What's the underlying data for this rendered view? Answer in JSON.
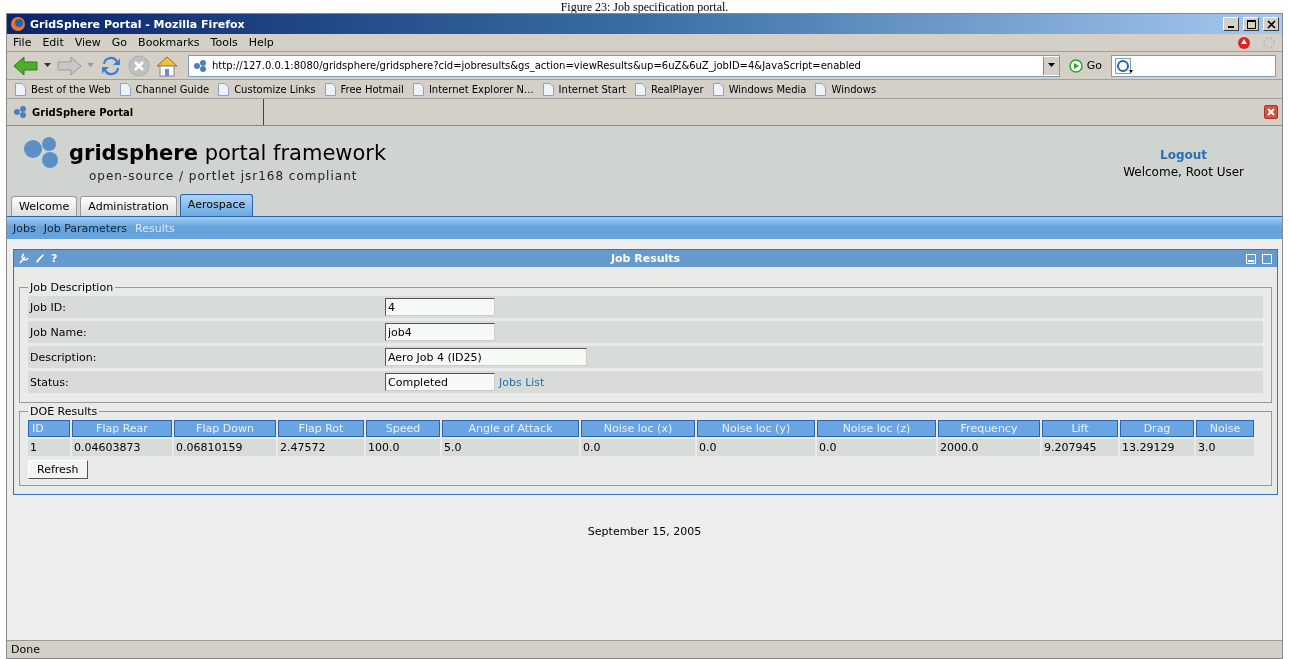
{
  "caption": "Figure 23: Job specification portal.",
  "window": {
    "title": "GridSphere Portal - Mozilla Firefox"
  },
  "menu": [
    "File",
    "Edit",
    "View",
    "Go",
    "Bookmarks",
    "Tools",
    "Help"
  ],
  "address": {
    "value": "http://127.0.0.1:8080/gridsphere/gridsphere?cid=jobresults&gs_action=viewResults&up=6uZ&6uZ_jobID=4&JavaScript=enabled",
    "go": "Go"
  },
  "bookmarks": [
    "Best of the Web",
    "Channel Guide",
    "Customize Links",
    "Free Hotmail",
    "Internet Explorer N...",
    "Internet Start",
    "RealPlayer",
    "Windows Media",
    "Windows"
  ],
  "browser_tab": {
    "label": "GridSphere Portal"
  },
  "portal": {
    "brand_bold": "gridsphere",
    "brand": "portal framework",
    "tagline": "open-source / portlet jsr168 compliant",
    "logout": "Logout",
    "welcome": "Welcome, Root User"
  },
  "tabs": [
    {
      "label": "Welcome",
      "selected": false
    },
    {
      "label": "Administration",
      "selected": false
    },
    {
      "label": "Aerospace",
      "selected": true
    }
  ],
  "subnav": [
    {
      "label": "Jobs",
      "selected": false
    },
    {
      "label": "Job Parameters",
      "selected": false
    },
    {
      "label": "Results",
      "selected": true
    }
  ],
  "portlet": {
    "title": "Job Results",
    "help": "?",
    "job_description": {
      "legend": "Job Description",
      "fields": [
        {
          "label": "Job ID:",
          "value": "4",
          "kind": "short"
        },
        {
          "label": "Job Name:",
          "value": "job4",
          "kind": "short"
        },
        {
          "label": "Description:",
          "value": "Aero Job 4 (ID25)",
          "kind": "long"
        },
        {
          "label": "Status:",
          "value": "Completed",
          "kind": "short",
          "link": "Jobs List"
        }
      ]
    },
    "doe_results": {
      "legend": "DOE Results",
      "columns": [
        "ID",
        "Flap Rear",
        "Flap Down",
        "Flap Rot",
        "Speed",
        "Angle of Attack",
        "Noise loc (x)",
        "Noise loc (y)",
        "Noise loc (z)",
        "Frequency",
        "Lift",
        "Drag",
        "Noise"
      ],
      "rows": [
        [
          "1",
          "0.04603873",
          "0.06810159",
          "2.47572",
          "100.0",
          "5.0",
          "0.0",
          "0.0",
          "0.0",
          "2000.0",
          "9.207945",
          "13.29129",
          "3.0"
        ]
      ],
      "button": "Refresh"
    }
  },
  "footer": "September 15, 2005",
  "status_bar": "Done"
}
